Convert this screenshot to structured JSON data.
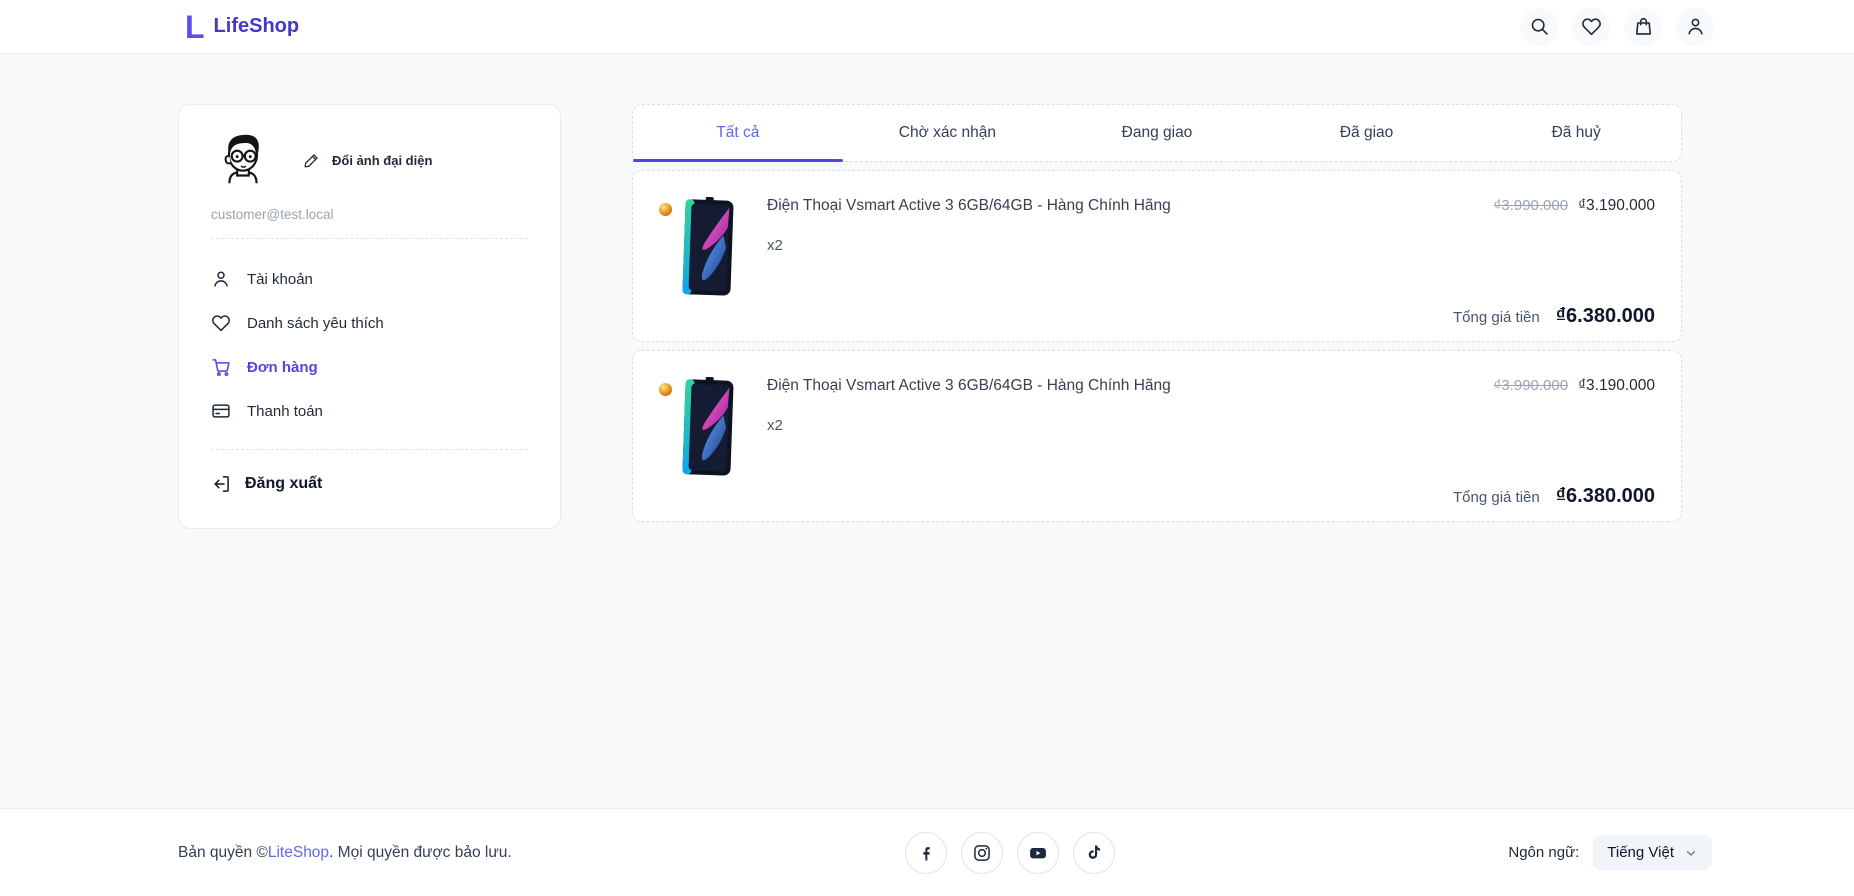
{
  "accent_color": "#4f46e5",
  "active_tab_color": "#6366f1",
  "header": {
    "brand_mark": "L",
    "brand": "LifeShop",
    "icons": [
      "search-icon",
      "wishlist-heart-icon",
      "shopping-bag-icon",
      "account-icon"
    ]
  },
  "sidebar": {
    "avatar": "line-art-man-with-glasses",
    "change_avatar_label": "Đổi ảnh đại diện",
    "email": "customer@test.local",
    "menu": [
      {
        "icon": "user-icon",
        "label": "Tài khoản",
        "active": false
      },
      {
        "icon": "heart-icon",
        "label": "Danh sách yêu thích",
        "active": false
      },
      {
        "icon": "cart-icon",
        "label": "Đơn hàng",
        "active": true
      },
      {
        "icon": "credit-card-icon",
        "label": "Thanh toán",
        "active": false
      }
    ],
    "logout_label": "Đăng xuất"
  },
  "orders": {
    "tabs": [
      {
        "label": "Tất cả",
        "active": true
      },
      {
        "label": "Chờ xác nhận",
        "active": false
      },
      {
        "label": "Đang giao",
        "active": false
      },
      {
        "label": "Đã giao",
        "active": false
      },
      {
        "label": "Đã huỷ",
        "active": false
      }
    ],
    "items": [
      {
        "title": "Điện Thoại Vsmart Active 3 6GB/64GB - Hàng Chính Hãng",
        "quantity": "x2",
        "old_price": "₫3.990.000",
        "price": "₫3.190.000",
        "total_label": "Tổng giá tiền",
        "total": "₫6.380.000"
      },
      {
        "title": "Điện Thoại Vsmart Active 3 6GB/64GB - Hàng Chính Hãng",
        "quantity": "x2",
        "old_price": "₫3.990.000",
        "price": "₫3.190.000",
        "total_label": "Tổng giá tiền",
        "total": "₫6.380.000"
      }
    ]
  },
  "footer": {
    "copyright_prefix": "Bản quyền ©",
    "copyright_brand": "LiteShop",
    "copyright_suffix": ". Mọi quyền được bảo lưu.",
    "socials": [
      "facebook-icon",
      "instagram-icon",
      "youtube-icon",
      "tiktok-icon"
    ],
    "language_label": "Ngôn ngữ:",
    "language_value": "Tiếng Việt"
  }
}
